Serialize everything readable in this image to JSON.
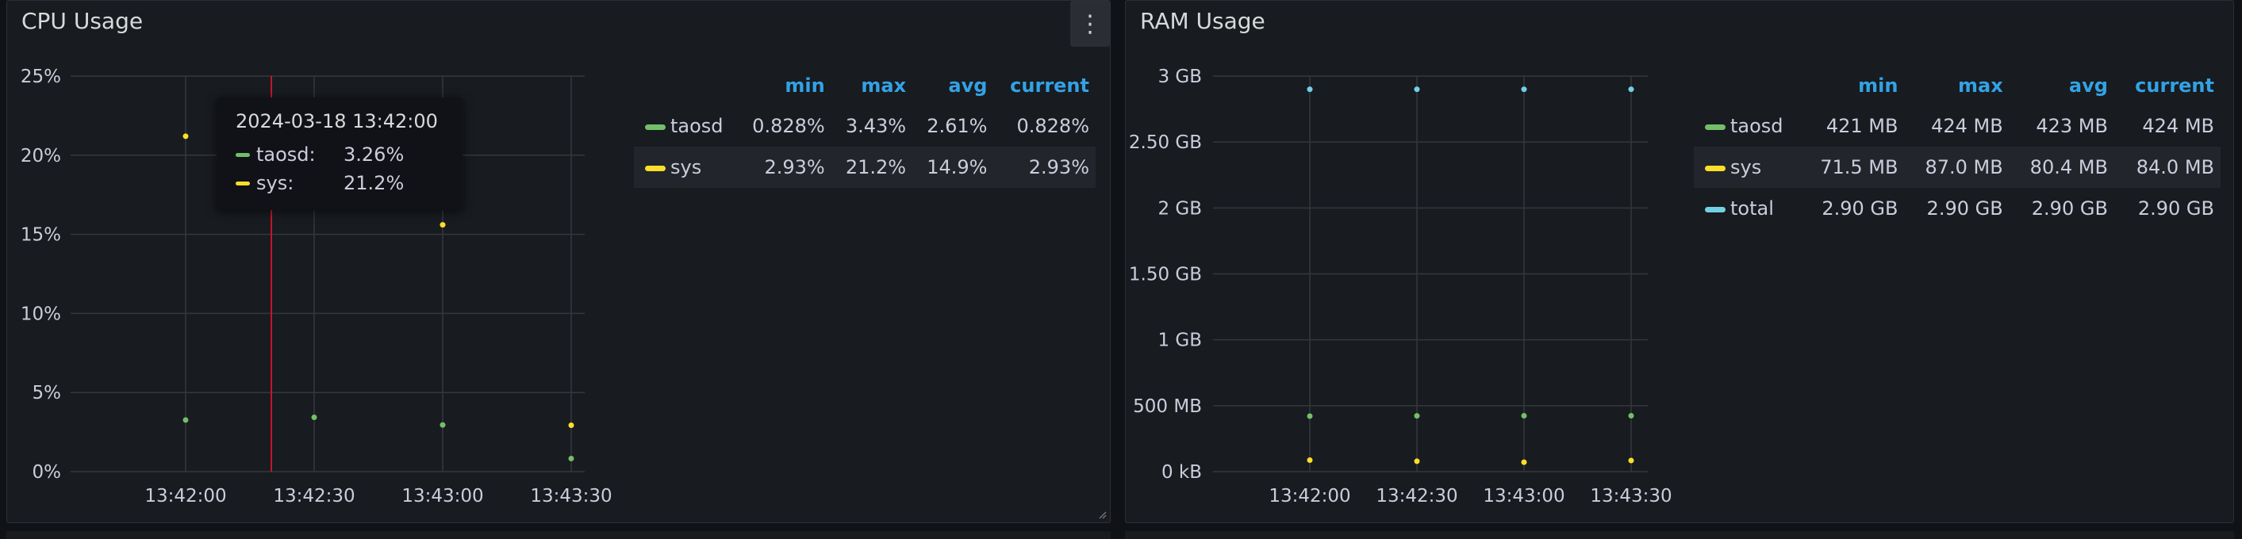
{
  "cpu_panel": {
    "title": "CPU Usage",
    "legend": {
      "headers": [
        "min",
        "max",
        "avg",
        "current"
      ],
      "rows": [
        {
          "name": "taosd",
          "color": "#73bf69",
          "min": "0.828%",
          "max": "3.43%",
          "avg": "2.61%",
          "current": "0.828%"
        },
        {
          "name": "sys",
          "color": "#fade2a",
          "min": "2.93%",
          "max": "21.2%",
          "avg": "14.9%",
          "current": "2.93%"
        }
      ]
    },
    "tooltip": {
      "time": "2024-03-18 13:42:00",
      "rows": [
        {
          "name": "taosd:",
          "value": "3.26%",
          "color": "#73bf69"
        },
        {
          "name": "sys:",
          "value": "21.2%",
          "color": "#fade2a"
        }
      ]
    }
  },
  "ram_panel": {
    "title": "RAM Usage",
    "legend": {
      "headers": [
        "min",
        "max",
        "avg",
        "current"
      ],
      "rows": [
        {
          "name": "taosd",
          "color": "#73bf69",
          "min": "421 MB",
          "max": "424 MB",
          "avg": "423 MB",
          "current": "424 MB"
        },
        {
          "name": "sys",
          "color": "#fade2a",
          "min": "71.5 MB",
          "max": "87.0 MB",
          "avg": "80.4 MB",
          "current": "84.0 MB"
        },
        {
          "name": "total",
          "color": "#73d0e2",
          "min": "2.90 GB",
          "max": "2.90 GB",
          "avg": "2.90 GB",
          "current": "2.90 GB"
        }
      ]
    }
  },
  "chart_data": [
    {
      "type": "scatter",
      "title": "CPU Usage",
      "x": [
        "13:42:00",
        "13:42:30",
        "13:43:00",
        "13:43:30"
      ],
      "x_ticks": [
        "13:42:00",
        "13:42:30",
        "13:43:00",
        "13:43:30"
      ],
      "y_ticks": [
        "0%",
        "5%",
        "10%",
        "15%",
        "20%",
        "25%"
      ],
      "ylim": [
        0,
        25
      ],
      "grid": true,
      "legend_position": "right",
      "hover_x": "13:42:20",
      "series": [
        {
          "name": "taosd",
          "color": "#73bf69",
          "values": [
            3.26,
            3.43,
            2.95,
            0.828
          ]
        },
        {
          "name": "sys",
          "color": "#fade2a",
          "values": [
            21.2,
            null,
            15.6,
            2.93
          ]
        }
      ]
    },
    {
      "type": "scatter",
      "title": "RAM Usage",
      "x": [
        "13:42:00",
        "13:42:30",
        "13:43:00",
        "13:43:30"
      ],
      "x_ticks": [
        "13:42:00",
        "13:42:30",
        "13:43:00",
        "13:43:30"
      ],
      "y_ticks": [
        "0 kB",
        "500 MB",
        "1 GB",
        "1.50 GB",
        "2 GB",
        "2.50 GB",
        "3 GB"
      ],
      "ylim": [
        0,
        3000
      ],
      "grid": true,
      "legend_position": "right",
      "series": [
        {
          "name": "taosd",
          "color": "#73bf69",
          "values": [
            421,
            423,
            424,
            424
          ]
        },
        {
          "name": "sys",
          "color": "#fade2a",
          "values": [
            87.0,
            79.0,
            71.5,
            84.0
          ]
        },
        {
          "name": "total",
          "color": "#73d0e2",
          "values": [
            2900,
            2900,
            2900,
            2900
          ]
        }
      ]
    }
  ]
}
